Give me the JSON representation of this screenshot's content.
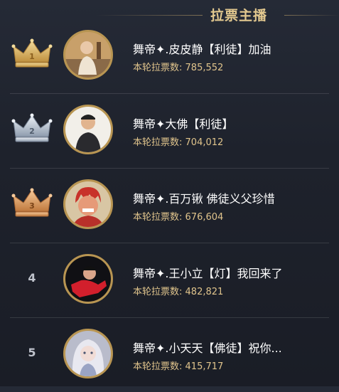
{
  "header": {
    "title": "拉票主播"
  },
  "streamers": [
    {
      "rank": "1",
      "rank_display": "crown",
      "crown_color": "#d8b36a",
      "name": "舞帝✦.皮皮静【利徒】加油",
      "votes_label": "本轮拉票数:",
      "votes": "785,552"
    },
    {
      "rank": "2",
      "rank_display": "crown",
      "crown_color": "#b9c4d2",
      "name": "舞帝✦大佛【利徒】",
      "votes_label": "本轮拉票数:",
      "votes": "704,012"
    },
    {
      "rank": "3",
      "rank_display": "crown",
      "crown_color": "#dba56a",
      "name": "舞帝✦.百万锹 佛徒义父珍惜",
      "votes_label": "本轮拉票数:",
      "votes": "676,604"
    },
    {
      "rank": "4",
      "rank_display": "number",
      "name": "舞帝✦.王小立【灯】我回来了",
      "votes_label": "本轮拉票数:",
      "votes": "482,821"
    },
    {
      "rank": "5",
      "rank_display": "number",
      "name": "舞帝✦.小天天【佛徒】祝你...",
      "votes_label": "本轮拉票数:",
      "votes": "415,717"
    }
  ]
}
